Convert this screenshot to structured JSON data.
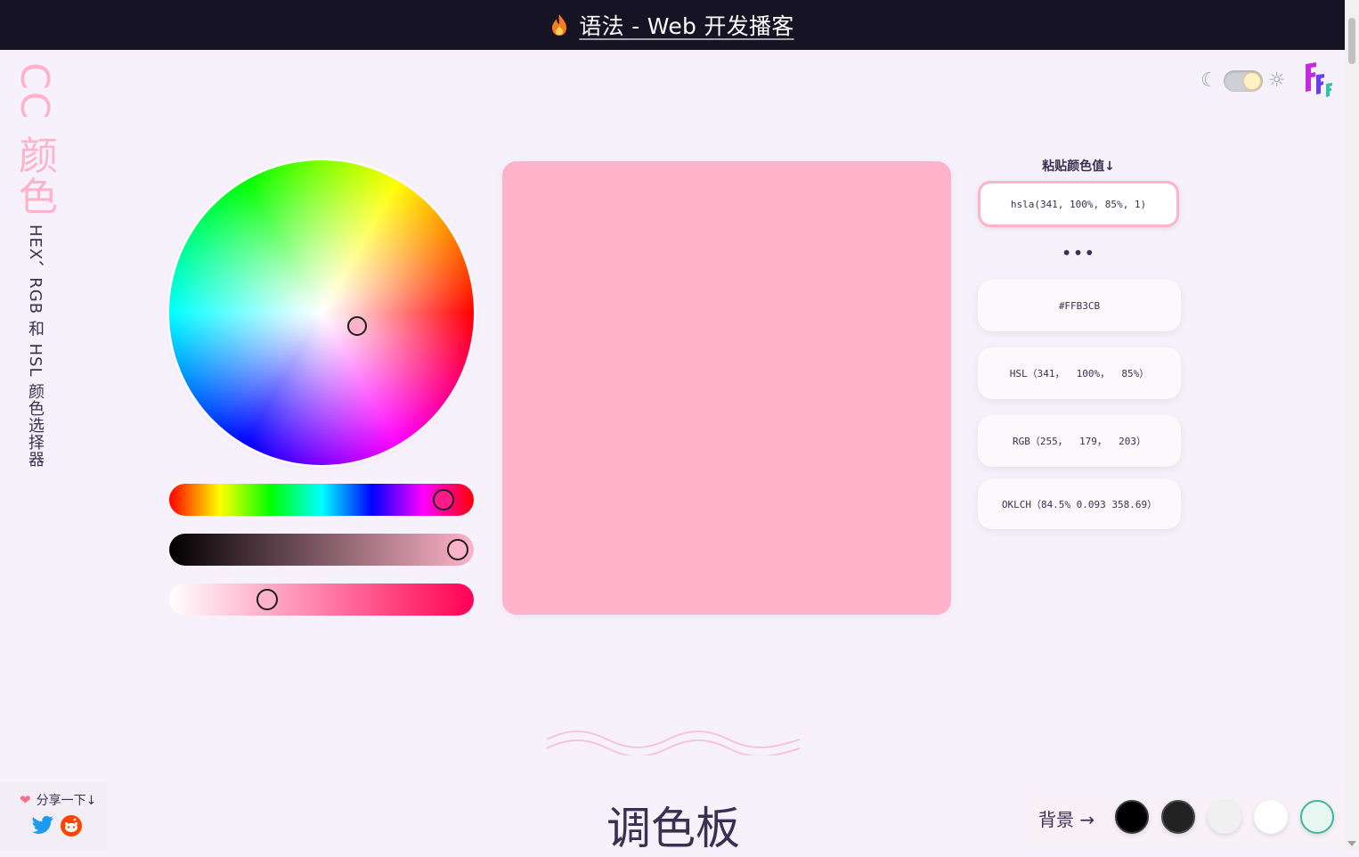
{
  "header": {
    "title": "语法 - Web 开发播客"
  },
  "sidebar": {
    "title": "CC 颜色",
    "subtitle": "HEX、RGB 和 HSL 颜色选择器"
  },
  "picker": {
    "current_color": "#FFB3CB",
    "hue": 341,
    "saturation_percent": 100,
    "lightness_percent": 85,
    "alpha": 1
  },
  "paste": {
    "label": "粘贴颜色值↓",
    "value": "hsla(341, 100%, 85%, 1)"
  },
  "ellipsis": "•••",
  "values": {
    "hex": "#FFB3CB",
    "hsl": "HSL（341，  100%，  85%）",
    "rgb": "RGB（255，  179，  203）",
    "oklch": "OKLCH（84.5% 0.093 358.69）"
  },
  "page_heading": "调色板",
  "share": {
    "label": "分享一下↓"
  },
  "background": {
    "label": "背景 →",
    "swatches": [
      "#000000",
      "#222222",
      "#f0f0f0",
      "#ffffff",
      "#e8f6f2"
    ]
  },
  "colors": {
    "accent": "#ffb3cb",
    "topbar": "#161325",
    "text": "#3b2f52"
  }
}
